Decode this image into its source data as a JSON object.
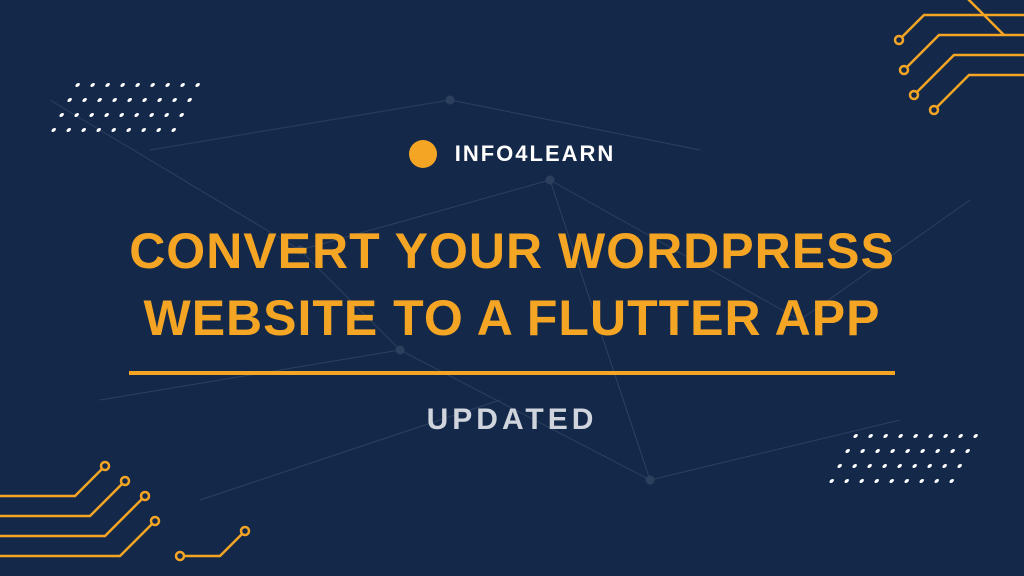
{
  "brand": {
    "name": "INFO4LEARN"
  },
  "headline": {
    "line1": "CONVERT YOUR WORDPRESS",
    "line2": "WEBSITE TO A FLUTTER APP"
  },
  "subtitle": "UPDATED",
  "colors": {
    "background": "#14294a",
    "accent": "#f5a524",
    "text_primary": "#ffffff",
    "text_secondary": "#d0d5dd"
  }
}
